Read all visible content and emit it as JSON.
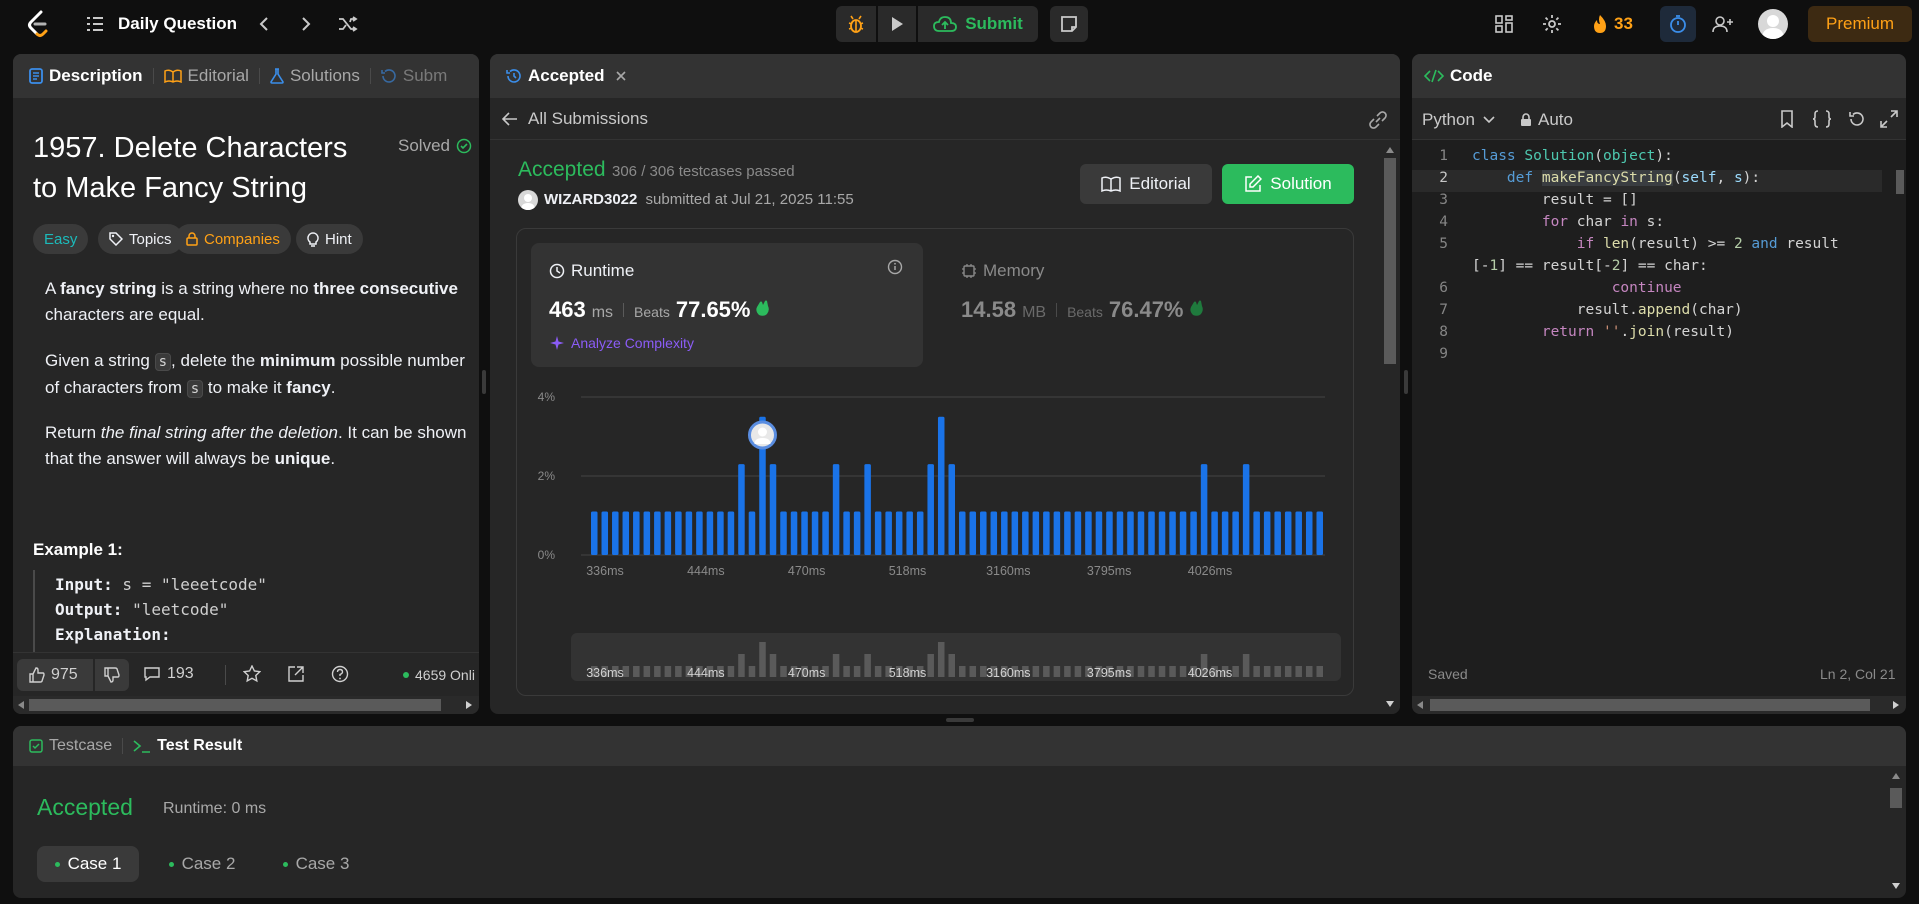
{
  "topbar": {
    "problem_list_label": "Daily Question",
    "submit_label": "Submit",
    "streak_count": "33",
    "premium_label": "Premium"
  },
  "description_panel": {
    "tabs": [
      "Description",
      "Editorial",
      "Solutions",
      "Subm"
    ],
    "title_line1": "1957. Delete Characters",
    "title_line2": "to Make Fancy String",
    "solved_label": "Solved",
    "chips": {
      "difficulty": "Easy",
      "topics": "Topics",
      "companies": "Companies",
      "hint": "Hint"
    },
    "p1": {
      "a": "A ",
      "b": "fancy string",
      "c": " is a string where no ",
      "d": "three consecutive",
      "e": "characters are equal."
    },
    "p2": {
      "a": "Given a string ",
      "code1": "s",
      "b": ", delete the ",
      "c": "minimum",
      "d": " possible number",
      "e": "of characters from ",
      "code2": "s",
      "f": " to make it ",
      "g": "fancy",
      "h": "."
    },
    "p3": {
      "a": "Return ",
      "b": "the final string after the deletion",
      "c": ". It can be shown",
      "d": "that the answer will always be ",
      "e": "unique",
      "f": "."
    },
    "example_title": "Example 1:",
    "example": {
      "input_label": "Input:",
      "input_value": " s = \"leeetcode\"",
      "output_label": "Output:",
      "output_value": " \"leetcode\"",
      "explanation_label": "Explanation:"
    },
    "footer": {
      "likes": "975",
      "comments": "193",
      "online": "4659 Onli"
    }
  },
  "result_panel": {
    "tab_label": "Accepted",
    "back_label": "All Submissions",
    "status": "Accepted",
    "testcases": "306 / 306 testcases passed",
    "user": "WIZARD3022",
    "submitted_at": "submitted at Jul 21, 2025 11:55",
    "editorial_button": "Editorial",
    "solution_button": "Solution",
    "runtime": {
      "title": "Runtime",
      "value": "463",
      "unit": "ms",
      "beats_label": "Beats",
      "beats_value": "77.65%",
      "analyze_label": "Analyze Complexity"
    },
    "memory": {
      "title": "Memory",
      "value": "14.58",
      "unit": "MB",
      "beats_label": "Beats",
      "beats_value": "76.47%"
    }
  },
  "chart_data": {
    "type": "bar",
    "y_ticks": [
      "4%",
      "2%",
      "0%"
    ],
    "ylim": [
      0,
      4
    ],
    "x_tick_labels": [
      "336ms",
      "444ms",
      "470ms",
      "518ms",
      "3160ms",
      "3795ms",
      "4026ms"
    ],
    "values": [
      1.1,
      1.1,
      1.1,
      1.1,
      1.1,
      1.1,
      1.1,
      1.1,
      1.1,
      1.1,
      1.1,
      1.1,
      1.1,
      1.1,
      2.3,
      1.1,
      3.5,
      2.3,
      1.1,
      1.1,
      1.1,
      1.1,
      1.1,
      2.3,
      1.1,
      1.1,
      2.3,
      1.1,
      1.1,
      1.1,
      1.1,
      1.1,
      2.3,
      3.5,
      2.3,
      1.1,
      1.1,
      1.1,
      1.1,
      1.1,
      1.1,
      1.1,
      1.1,
      1.1,
      1.1,
      1.1,
      1.1,
      1.1,
      1.1,
      1.1,
      1.1,
      1.1,
      1.1,
      1.1,
      1.1,
      1.1,
      1.1,
      1.1,
      2.3,
      1.1,
      1.1,
      1.1,
      2.3,
      1.1,
      1.1,
      1.1,
      1.1,
      1.1,
      1.1,
      1.1
    ],
    "colors": {
      "bar": "#1a73e8",
      "minimap_bar": "#5a5a5a"
    },
    "highlight_index": 16
  },
  "code_panel": {
    "title": "Code",
    "language": "Python",
    "auto_label": "Auto",
    "status": "Saved",
    "cursor": "Ln 2, Col 21"
  },
  "code_lines": [
    "1",
    "2",
    "3",
    "4",
    "5",
    "6",
    "7",
    "8",
    "9"
  ],
  "bottom_panel": {
    "tabs": {
      "testcase": "Testcase",
      "result": "Test Result"
    },
    "status": "Accepted",
    "runtime": "Runtime: 0 ms",
    "cases": [
      "Case 1",
      "Case 2",
      "Case 3"
    ]
  }
}
